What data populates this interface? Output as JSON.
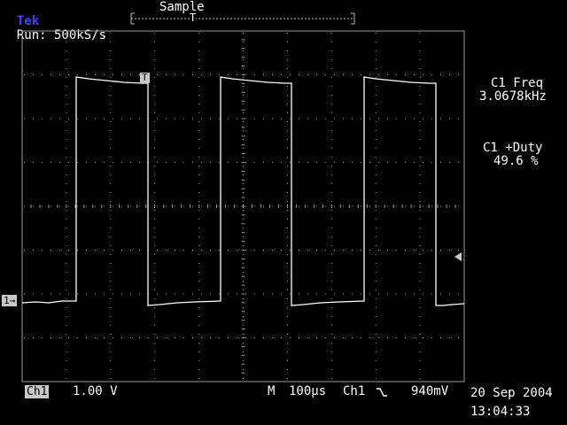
{
  "header": {
    "brand": "Tek",
    "run_status": "Run: 500kS/s",
    "acq_mode": "Sample",
    "trigger_pos_marker": "T"
  },
  "measurements": [
    {
      "label": "C1 Freq",
      "value": "3.0678kHz"
    },
    {
      "label": "C1 +Duty",
      "value": "49.6 %"
    }
  ],
  "markers": {
    "channel1": "1→",
    "trigger_point": "T",
    "trigger_level_icon": "left-arrow-icon"
  },
  "footer": {
    "channel": "Ch1",
    "volts_div": "1.00 V",
    "timebase_label": "M",
    "timebase": "100µs",
    "trig_source": "Ch1",
    "trig_slope_icon": "falling-edge-icon",
    "trig_level": "940mV",
    "date": "20 Sep 2004",
    "time": "13:04:33"
  },
  "colors": {
    "brand": "#4040ff",
    "trace": "#ffffff",
    "graticule": "#9a9a9a",
    "label_box": "#c8c8c8"
  }
}
